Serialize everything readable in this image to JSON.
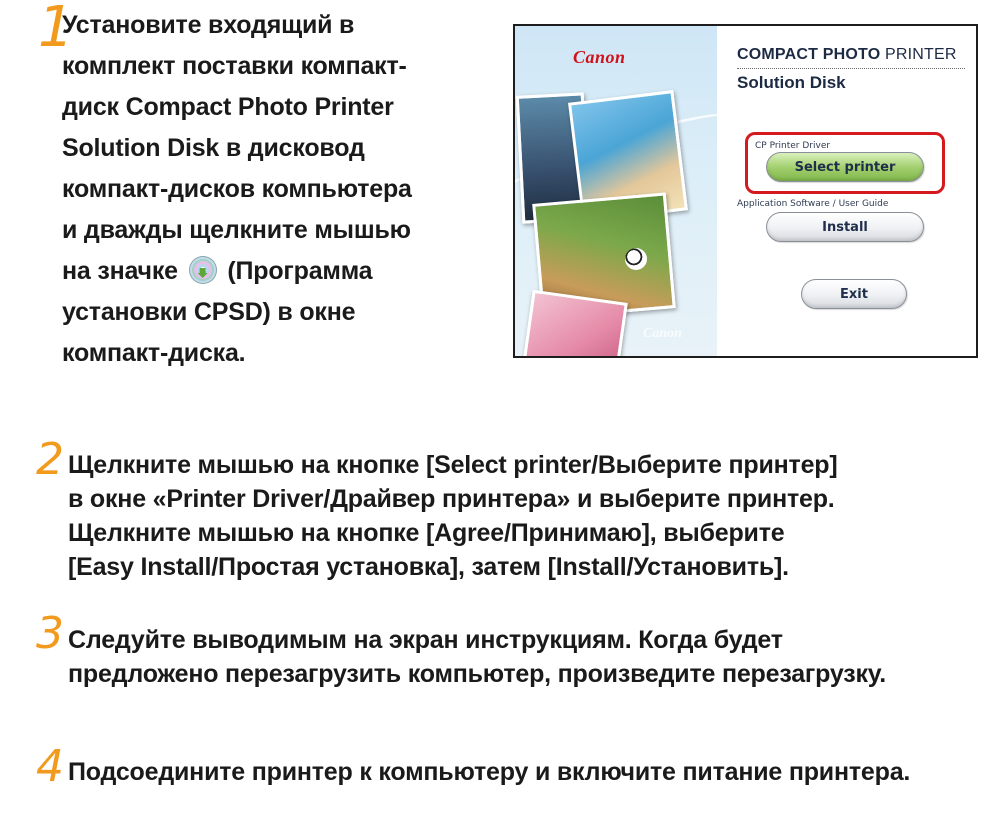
{
  "steps": [
    {
      "number": "1",
      "lines": [
        "Установите входящий в",
        "комплект поставки компакт-",
        "диск Compact Photo Printer",
        "Solution Disk в дисковод",
        "компакт-дисков компьютера",
        "и дважды щелкните мышью"
      ],
      "icon_line_prefix": "на значке",
      "icon": "cd-installer-icon",
      "icon_line_suffix": "(Программа",
      "tail_lines": [
        "установки CPSD) в окне",
        "компакт-диска."
      ]
    },
    {
      "number": "2",
      "lines": [
        "Щелкните мышью на кнопке [Select printer/Выберите принтер]",
        "в окне «Printer Driver/Драйвер принтера» и выберите принтер.",
        "Щелкните мышью на кнопке [Agree/Принимаю], выберите",
        "[Easy Install/Простая установка], затем [Install/Установить]."
      ]
    },
    {
      "number": "3",
      "lines": [
        "Следуйте выводимым на экран инструкциям. Когда будет",
        "предложено перезагрузить компьютер, произведите перезагрузку."
      ]
    },
    {
      "number": "4",
      "lines": [
        "Подсоедините принтер к компьютеру и включите питание принтера."
      ]
    }
  ],
  "screenshot": {
    "logo": "Canon",
    "product_bold": "COMPACT PHOTO",
    "product_regular": "PRINTER",
    "subtitle": "Solution Disk",
    "driver_label": "CP Printer Driver",
    "select_printer_button": "Select printer",
    "app_label": "Application Software / User Guide",
    "install_button": "Install",
    "exit_button": "Exit",
    "watermark": "Canon",
    "highlight_color": "#d51a1f"
  },
  "colors": {
    "step_number": "#f29a1e",
    "text": "#1a1a1a",
    "brand_red": "#d0121b"
  }
}
